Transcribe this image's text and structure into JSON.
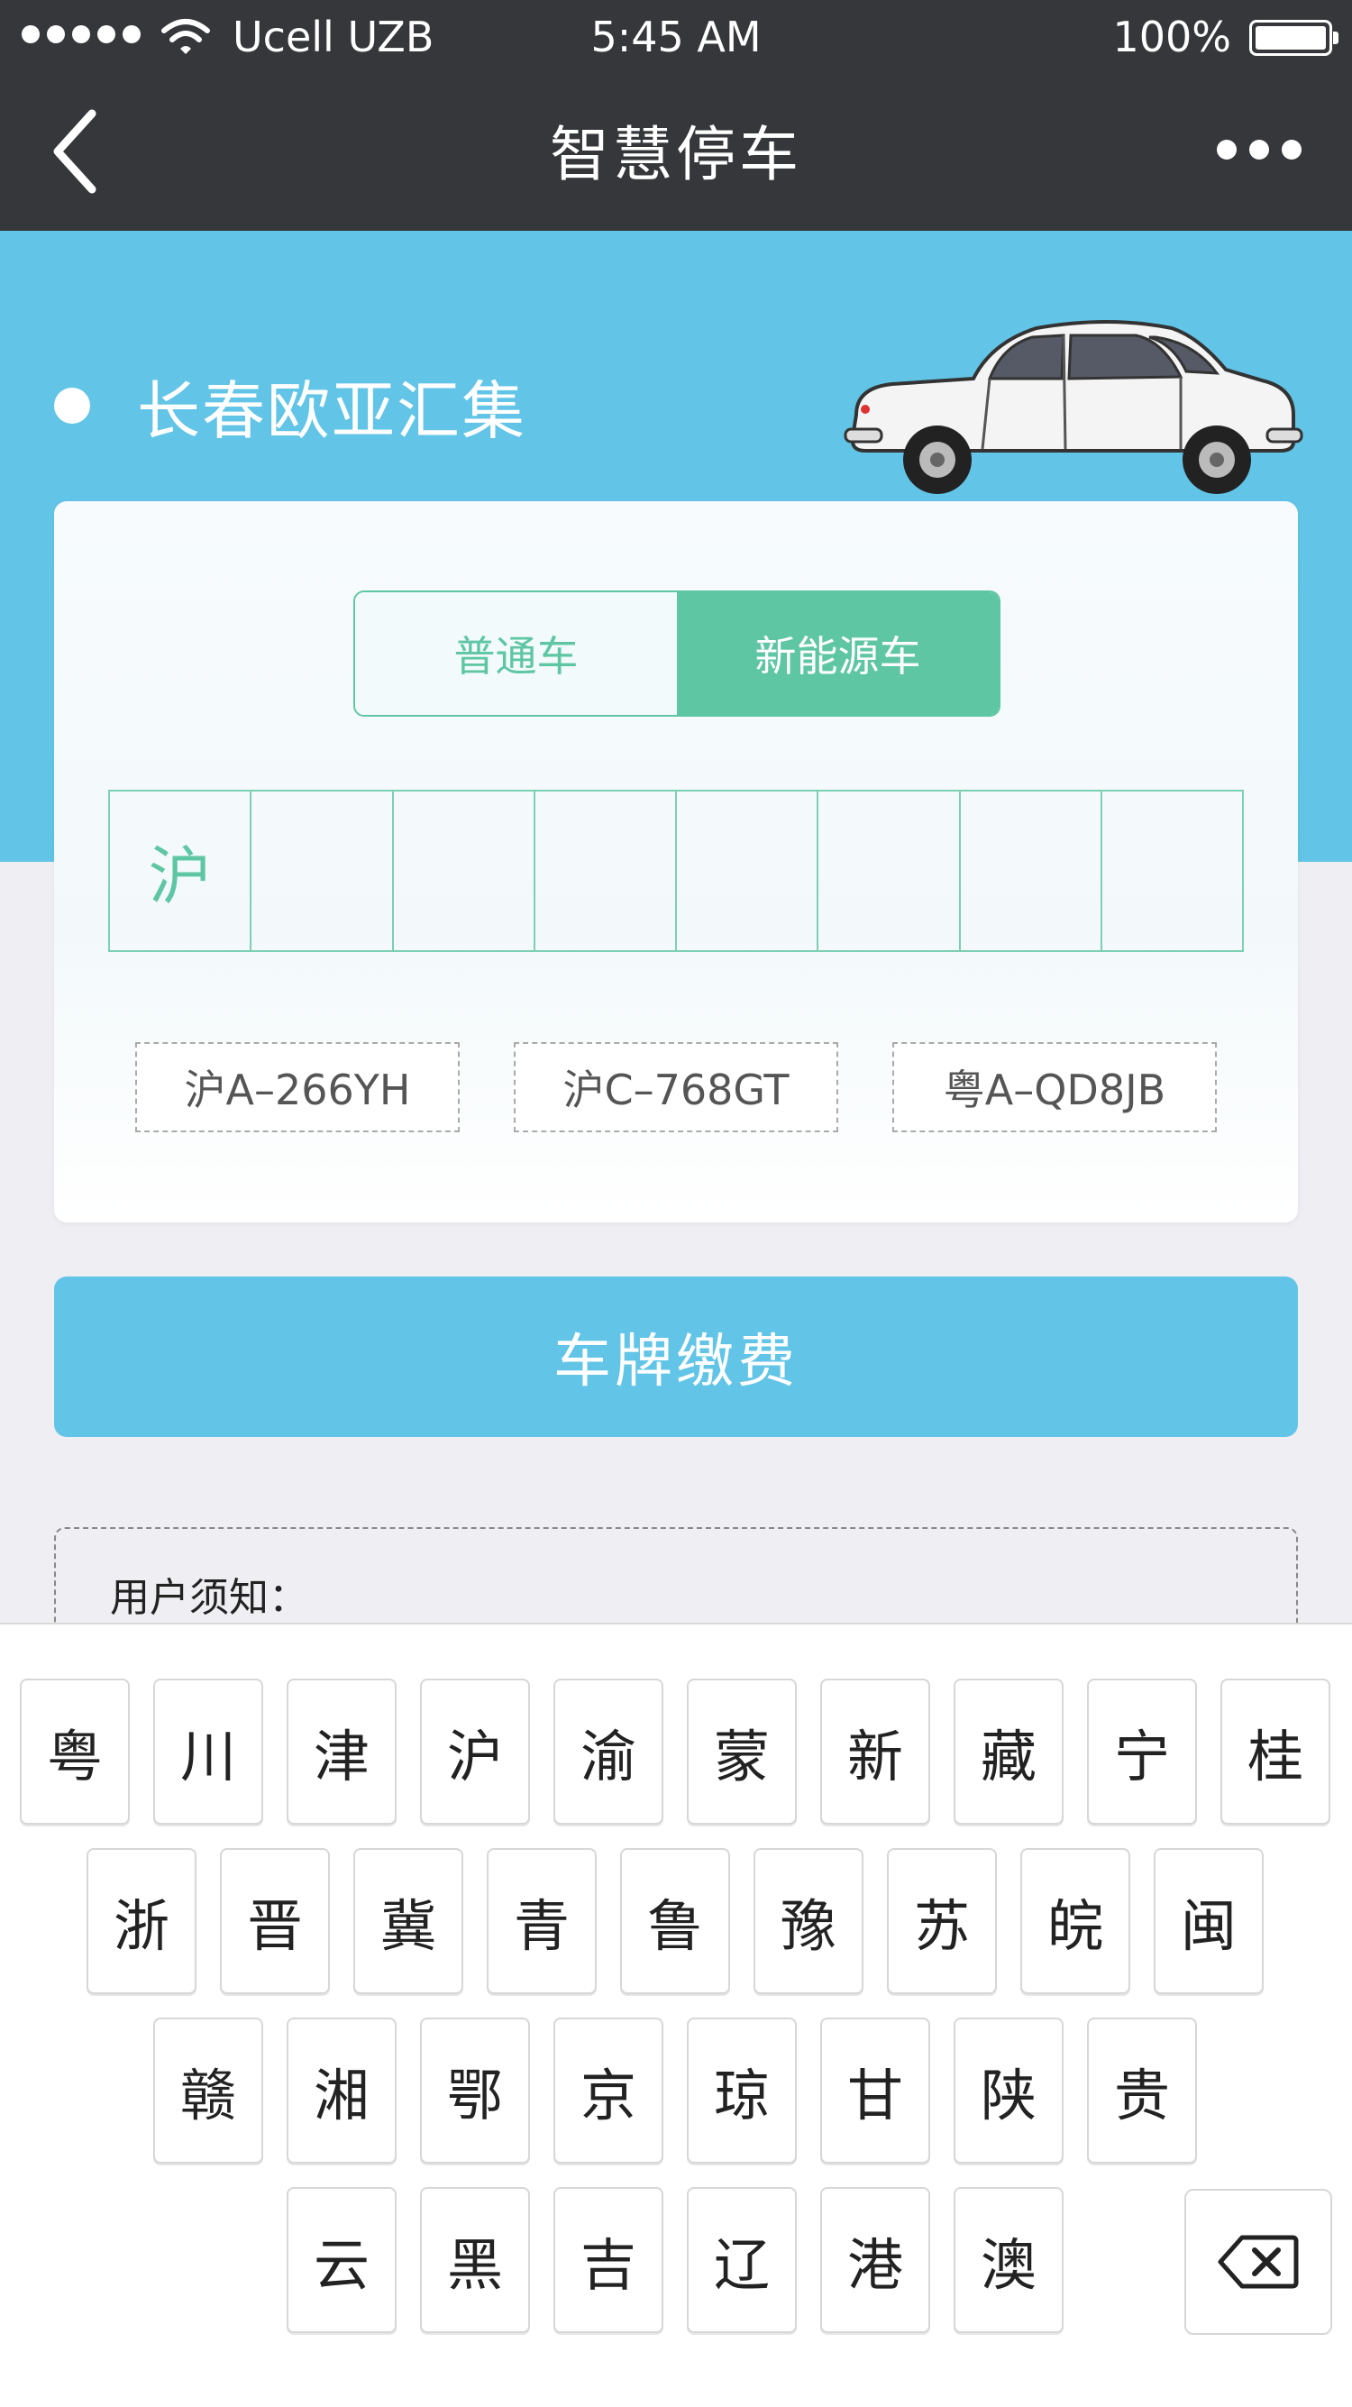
{
  "status_bar": {
    "carrier": "Ucell UZB",
    "time": "5:45 AM",
    "battery": "100%"
  },
  "nav": {
    "title": "智慧停车"
  },
  "lot": {
    "name": "长春欧亚汇集"
  },
  "vehicle_type": {
    "options": [
      "普通车",
      "新能源车"
    ],
    "selected": "新能源车"
  },
  "plate": {
    "cells": [
      "沪",
      "",
      "",
      "",
      "",
      "",
      "",
      ""
    ]
  },
  "history": [
    "沪A–266YH",
    "沪C–768GT",
    "粤A–QD8JB"
  ],
  "pay_button": "车牌缴费",
  "notice": {
    "title": "用户须知："
  },
  "keyboard": {
    "rows": [
      [
        "粤",
        "川",
        "津",
        "沪",
        "渝",
        "蒙",
        "新",
        "藏",
        "宁",
        "桂"
      ],
      [
        "浙",
        "晋",
        "冀",
        "青",
        "鲁",
        "豫",
        "苏",
        "皖",
        "闽"
      ],
      [
        "赣",
        "湘",
        "鄂",
        "京",
        "琼",
        "甘",
        "陕",
        "贵"
      ],
      [
        "云",
        "黑",
        "吉",
        "辽",
        "港",
        "澳"
      ]
    ]
  },
  "colors": {
    "accent_blue": "#62c4e6",
    "accent_green": "#5ec6a2",
    "nav_dark": "#36373b"
  }
}
